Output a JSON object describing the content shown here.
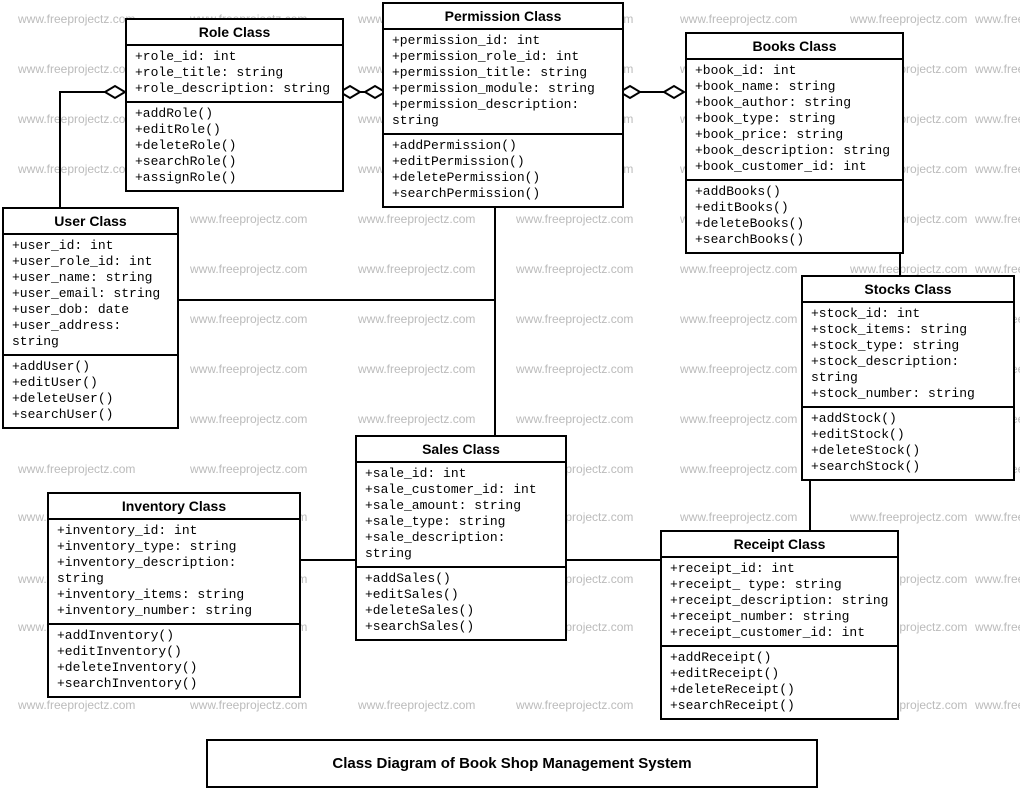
{
  "watermark": "www.freeprojectz.com",
  "diagram_title": "Class Diagram of Book Shop Management System",
  "classes": {
    "role": {
      "name": "Role Class",
      "attrs": [
        "+role_id: int",
        "+role_title: string",
        "+role_description: string"
      ],
      "ops": [
        "+addRole()",
        "+editRole()",
        "+deleteRole()",
        "+searchRole()",
        "+assignRole()"
      ]
    },
    "permission": {
      "name": "Permission Class",
      "attrs": [
        "+permission_id: int",
        "+permission_role_id: int",
        "+permission_title: string",
        "+permission_module: string",
        "+permission_description: string"
      ],
      "ops": [
        "+addPermission()",
        "+editPermission()",
        "+deletePermission()",
        "+searchPermission()"
      ]
    },
    "books": {
      "name": "Books Class",
      "attrs": [
        "+book_id: int",
        "+book_name: string",
        "+book_author: string",
        "+book_type: string",
        "+book_price: string",
        "+book_description: string",
        "+book_customer_id: int"
      ],
      "ops": [
        "+addBooks()",
        "+editBooks()",
        "+deleteBooks()",
        "+searchBooks()"
      ]
    },
    "user": {
      "name": "User Class",
      "attrs": [
        "+user_id: int",
        "+user_role_id: int",
        "+user_name: string",
        "+user_email: string",
        "+user_dob: date",
        "+user_address: string"
      ],
      "ops": [
        "+addUser()",
        "+editUser()",
        "+deleteUser()",
        "+searchUser()"
      ]
    },
    "stocks": {
      "name": "Stocks Class",
      "attrs": [
        "+stock_id: int",
        "+stock_items: string",
        "+stock_type: string",
        "+stock_description: string",
        "+stock_number: string"
      ],
      "ops": [
        "+addStock()",
        "+editStock()",
        "+deleteStock()",
        "+searchStock()"
      ]
    },
    "sales": {
      "name": "Sales Class",
      "attrs": [
        "+sale_id: int",
        "+sale_customer_id: int",
        "+sale_amount: string",
        "+sale_type: string",
        "+sale_description: string"
      ],
      "ops": [
        "+addSales()",
        "+editSales()",
        "+deleteSales()",
        "+searchSales()"
      ]
    },
    "inventory": {
      "name": "Inventory Class",
      "attrs": [
        "+inventory_id: int",
        "+inventory_type: string",
        "+inventory_description: string",
        "+inventory_items: string",
        "+inventory_number: string"
      ],
      "ops": [
        "+addInventory()",
        "+editInventory()",
        "+deleteInventory()",
        "+searchInventory()"
      ]
    },
    "receipt": {
      "name": "Receipt Class",
      "attrs": [
        "+receipt_id: int",
        "+receipt_ type: string",
        "+receipt_description: string",
        "+receipt_number: string",
        "+receipt_customer_id: int"
      ],
      "ops": [
        "+addReceipt()",
        "+editReceipt()",
        "+deleteReceipt()",
        "+searchReceipt()"
      ]
    }
  }
}
